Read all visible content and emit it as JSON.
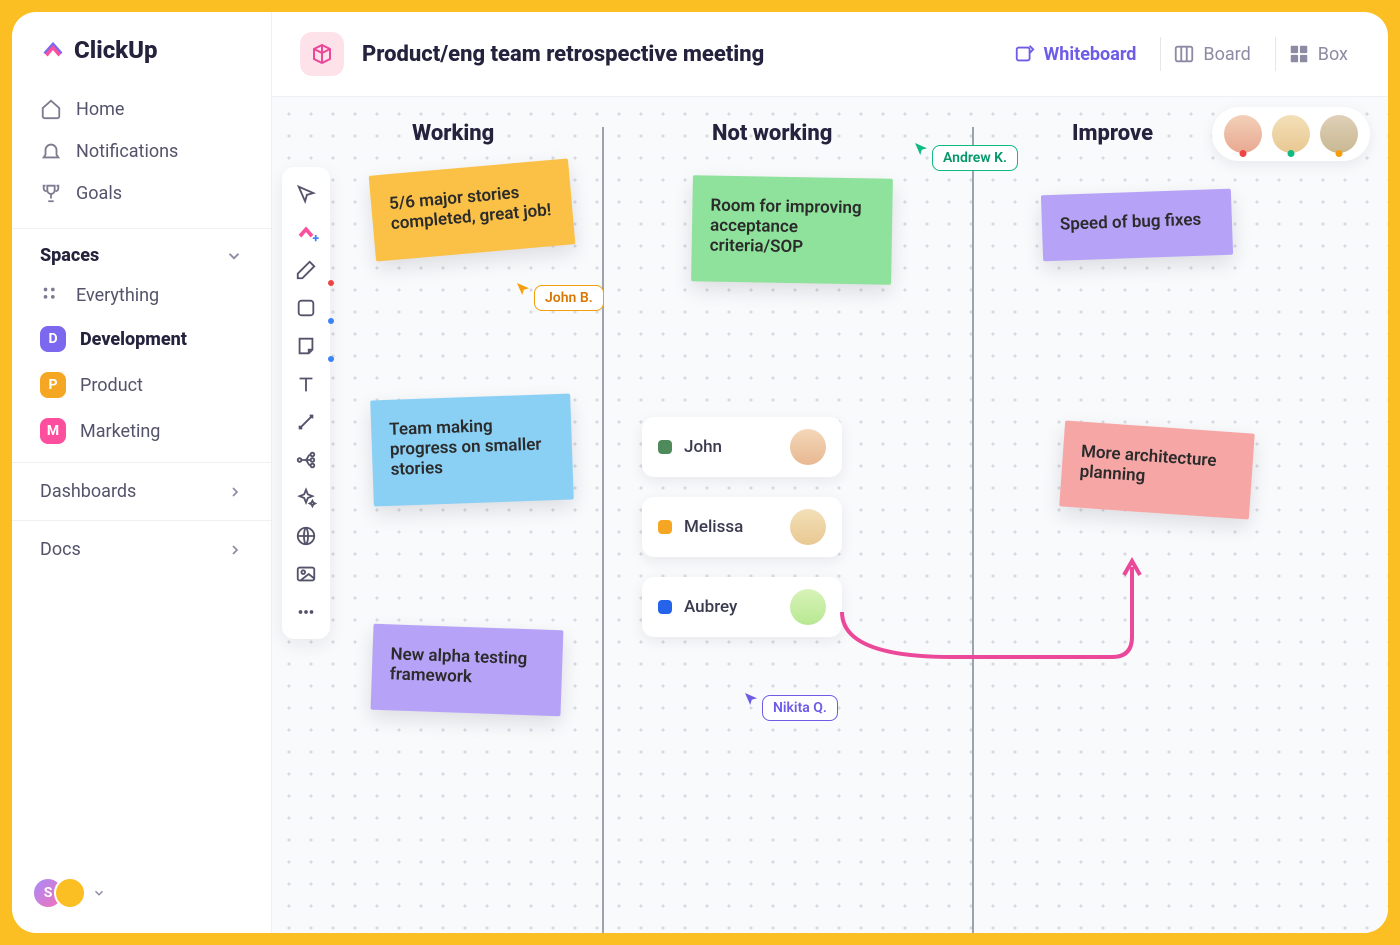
{
  "brand": "ClickUp",
  "nav": {
    "home": "Home",
    "notifications": "Notifications",
    "goals": "Goals"
  },
  "spaces": {
    "header": "Spaces",
    "everything": "Everything",
    "items": [
      {
        "badge": "D",
        "label": "Development",
        "color": "#7b68ee"
      },
      {
        "badge": "P",
        "label": "Product",
        "color": "#f5a623"
      },
      {
        "badge": "M",
        "label": "Marketing",
        "color": "#fd4f9d"
      }
    ]
  },
  "sections": {
    "dashboards": "Dashboards",
    "docs": "Docs"
  },
  "user_badge": "S",
  "page": {
    "title": "Product/eng team retrospective meeting",
    "views": {
      "whiteboard": "Whiteboard",
      "board": "Board",
      "box": "Box"
    }
  },
  "columns": {
    "working": "Working",
    "not_working": "Not working",
    "improve": "Improve"
  },
  "stickies": {
    "s1": "5/6 major stories completed, great job!",
    "s2": "Team making progress on smaller stories",
    "s3": "New alpha testing framework",
    "s4": "Room for improving acceptance criteria/SOP",
    "s5": "Speed of bug fixes",
    "s6": "More architecture planning"
  },
  "cursors": {
    "john": "John B.",
    "andrew": "Andrew K.",
    "nikita": "Nikita Q."
  },
  "people": {
    "p1": "John",
    "p2": "Melissa",
    "p3": "Aubrey"
  },
  "colors": {
    "yellow": "#fac146",
    "blue": "#8ad0f4",
    "purple": "#b6a3f8",
    "green": "#8ee29b",
    "pink": "#f7a6a6",
    "violet": "#6c5ce7"
  }
}
